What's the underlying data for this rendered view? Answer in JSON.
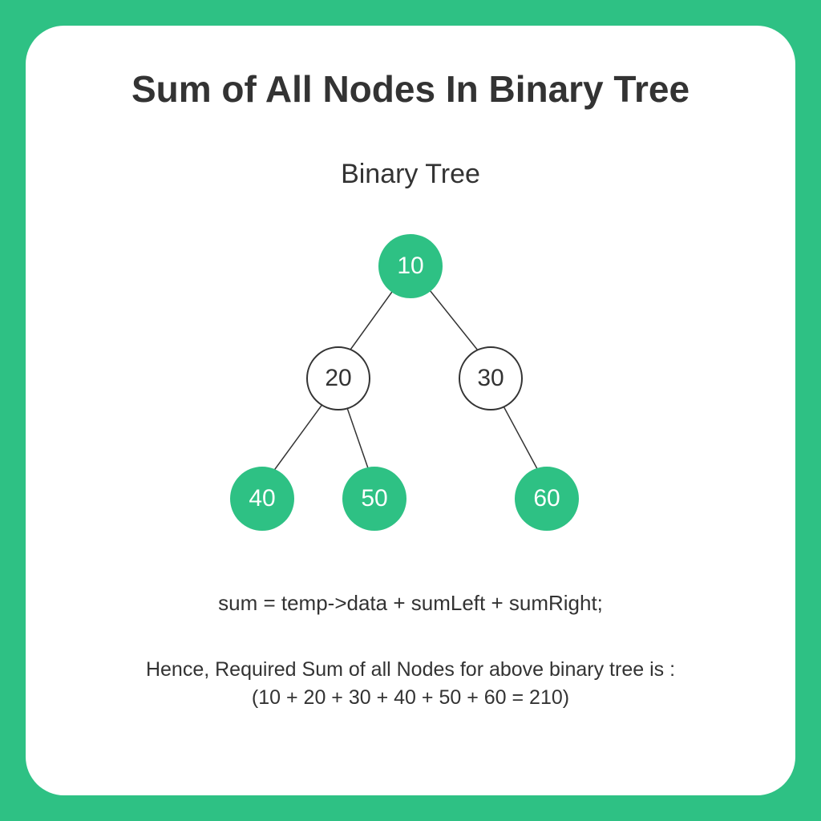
{
  "title": "Sum of All Nodes In Binary Tree",
  "subtitle": "Binary Tree",
  "nodes": {
    "root": "10",
    "left": "20",
    "right": "30",
    "leaf1": "40",
    "leaf2": "50",
    "leaf3": "60"
  },
  "formula": "sum = temp->data + sumLeft + sumRight;",
  "result_line1": "Hence, Required Sum of all Nodes for above binary tree is :",
  "result_line2": "(10 + 20 + 30 + 40 + 50 + 60 = 210)",
  "colors": {
    "accent": "#2ec184",
    "text": "#333333"
  }
}
